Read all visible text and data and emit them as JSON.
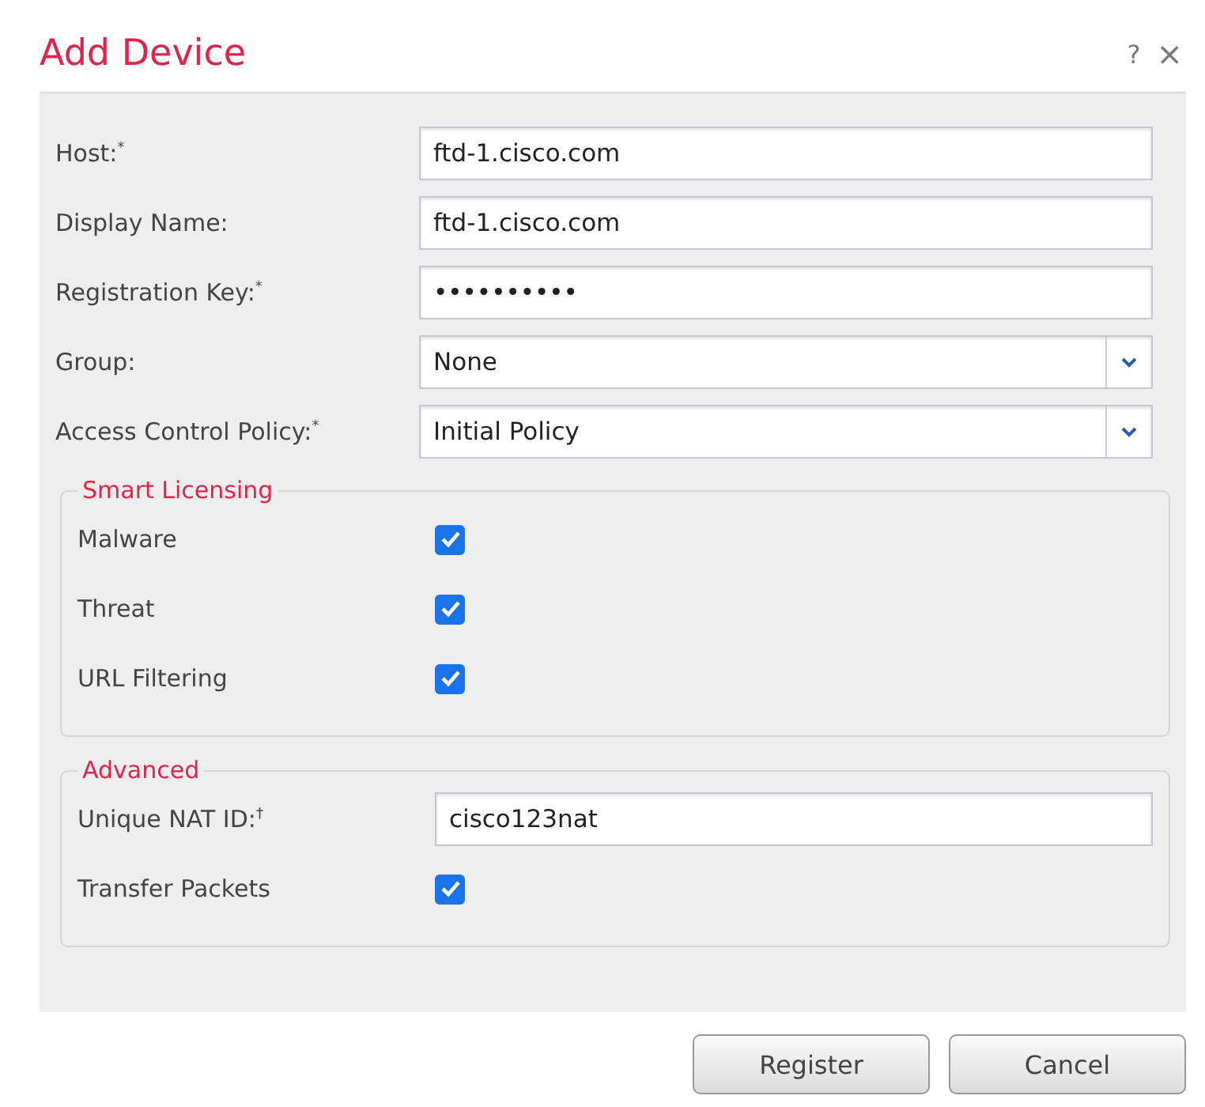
{
  "dialog": {
    "title": "Add Device",
    "help": "?",
    "close": "×"
  },
  "fields": [
    {
      "kind": "text",
      "label": "Host:$^{*}$",
      "value": "ftd-1.cisco.com"
    },
    {
      "kind": "text",
      "label": "Display Name:",
      "value": "ftd-1.cisco.com"
    },
    {
      "kind": "text",
      "label": "Registration Key:$^{*}$",
      "value": "••••••••••"
    },
    {
      "kind": "select",
      "label": "Group:",
      "value": "None"
    },
    {
      "kind": "select",
      "label": "Access Control Policy:$^{*}$",
      "value": "Initial Policy"
    }
  ],
  "sections": [
    {
      "title": "Smart Licensing",
      "rows": [
        {
          "kind": "checkbox",
          "label": "Malware",
          "checked": true
        },
        {
          "kind": "checkbox",
          "label": "Threat",
          "checked": true
        },
        {
          "kind": "checkbox",
          "label": "URL Filtering",
          "checked": true
        }
      ]
    },
    {
      "title": "Advanced",
      "rows": [
        {
          "kind": "text",
          "label": "Unique NAT ID:$^{†}$",
          "value": "cisco123nat"
        },
        {
          "kind": "checkbox",
          "label": "Transfer Packets",
          "checked": true
        }
      ]
    }
  ],
  "buttons": [
    "Register",
    "Cancel"
  ]
}
